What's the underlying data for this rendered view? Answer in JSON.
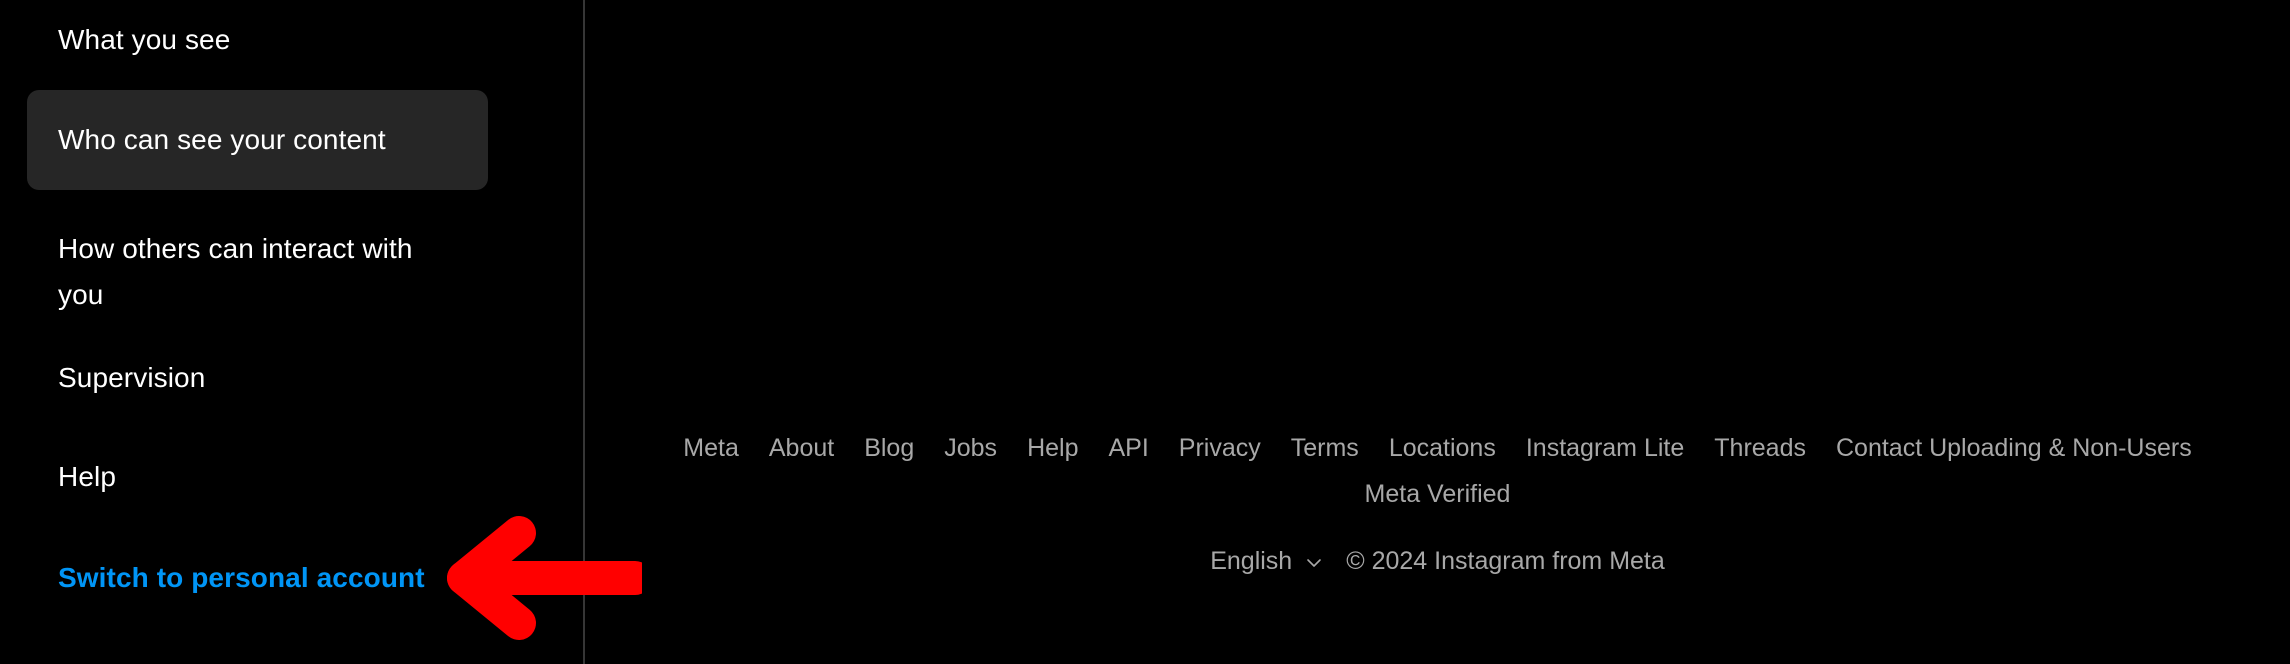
{
  "sidebar": {
    "items": [
      {
        "label": "What you see",
        "selected": false,
        "accent": false
      },
      {
        "label": "Who can see your content",
        "selected": true,
        "accent": false
      },
      {
        "label": "How others can interact with you",
        "selected": false,
        "accent": false
      },
      {
        "label": "Supervision",
        "selected": false,
        "accent": false
      },
      {
        "label": "Help",
        "selected": false,
        "accent": false
      },
      {
        "label": "Switch to personal account",
        "selected": false,
        "accent": true
      }
    ],
    "item_0_label": "What you see",
    "item_1_label": "Who can see your content",
    "item_2_label": "How others can interact with you",
    "item_3_label": "Supervision",
    "item_4_label": "Help",
    "item_5_label": "Switch to personal account"
  },
  "footer": {
    "links": [
      "Meta",
      "About",
      "Blog",
      "Jobs",
      "Help",
      "API",
      "Privacy",
      "Terms",
      "Locations",
      "Instagram Lite",
      "Threads",
      "Contact Uploading & Non-Users",
      "Meta Verified"
    ],
    "link_0": "Meta",
    "link_1": "About",
    "link_2": "Blog",
    "link_3": "Jobs",
    "link_4": "Help",
    "link_5": "API",
    "link_6": "Privacy",
    "link_7": "Terms",
    "link_8": "Locations",
    "link_9": "Instagram Lite",
    "link_10": "Threads",
    "link_11": "Contact Uploading & Non-Users",
    "link_12": "Meta Verified",
    "language": "English",
    "copyright": "© 2024 Instagram from Meta"
  },
  "annotation": {
    "type": "arrow-left",
    "color": "#FF0000",
    "points_to": "Switch to personal account"
  },
  "colors": {
    "background": "#000000",
    "selected_item_bg": "#262626",
    "accent_link": "#0095F6",
    "footer_text": "#A8A8A8",
    "divider": "#363636",
    "annotation_red": "#FF0000"
  },
  "icons": {
    "chevron_down": "chevron-down-icon"
  }
}
